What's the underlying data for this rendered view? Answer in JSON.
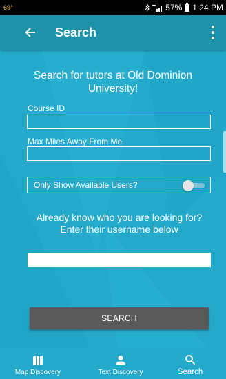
{
  "status_bar": {
    "temperature": "69°",
    "signal": "ᐢ︎ıll",
    "battery_percent": "57%",
    "time": "1:24 PM"
  },
  "app_bar": {
    "title": "Search"
  },
  "form": {
    "heading": "Search for tutors at Old Dominion University!",
    "course_id_label": "Course ID",
    "course_id_value": "",
    "max_miles_label": "Max Miles Away From Me",
    "max_miles_value": "",
    "only_available_label": "Only Show Available Users?",
    "only_available_checked": false,
    "username_heading": "Already know who you are looking for? Enter their username below",
    "username_value": "",
    "search_button_label": "SEARCH"
  },
  "bottom_nav": {
    "items": [
      {
        "label": "Map Discovery",
        "icon": "map-icon"
      },
      {
        "label": "Text Discovery",
        "icon": "person-icon"
      },
      {
        "label": "Search",
        "icon": "search-icon",
        "active": true
      }
    ]
  },
  "colors": {
    "app_bar": "#1d92a8",
    "content_bg": "#24a9cb",
    "button": "#5a5a5a",
    "status_bar": "#000000"
  }
}
